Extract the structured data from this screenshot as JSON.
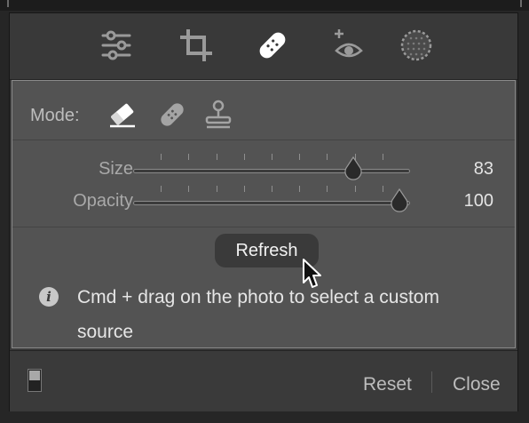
{
  "tools": [
    {
      "icon": "sliders-icon",
      "label": ""
    },
    {
      "icon": "crop-icon",
      "label": ""
    },
    {
      "icon": "healing-bandage-icon",
      "label": "",
      "active": true
    },
    {
      "icon": "red-eye-icon",
      "label": ""
    },
    {
      "icon": "mask-icon",
      "label": ""
    }
  ],
  "mode": {
    "label": "Mode:",
    "options": [
      {
        "icon": "eraser-icon",
        "selected": true
      },
      {
        "icon": "heal-icon",
        "selected": false
      },
      {
        "icon": "clone-stamp-icon",
        "selected": false
      }
    ]
  },
  "sliders": {
    "size": {
      "label": "Size",
      "value": "83",
      "fraction": 0.82
    },
    "opacity": {
      "label": "Opacity",
      "value": "100",
      "fraction": 1.0
    }
  },
  "refresh_label": "Refresh",
  "info": {
    "icon": "info-icon",
    "glyph": "i",
    "text": "Cmd + drag on the photo to select a custom source"
  },
  "footer": {
    "reset_label": "Reset",
    "close_label": "Close"
  },
  "colors": {
    "panel_bg": "#3a3a3a",
    "inner_bg": "#535353",
    "text_light": "#e6e6e6",
    "text_muted": "#bdbdbd"
  }
}
